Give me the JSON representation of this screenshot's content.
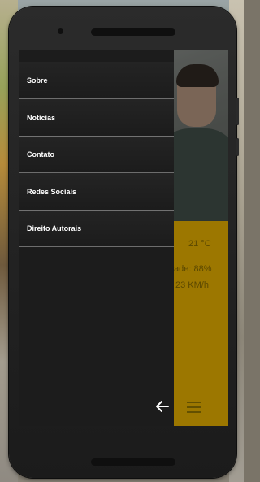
{
  "drawer": {
    "items": [
      {
        "label": "Sobre"
      },
      {
        "label": "Notícias"
      },
      {
        "label": "Contato"
      },
      {
        "label": "Redes Sociais"
      },
      {
        "label": "Direito Autorais"
      }
    ],
    "back_icon": "arrow-left-icon"
  },
  "weather": {
    "temperature": "21 °C",
    "humidity": "ade: 88%",
    "wind": "23 KM/h"
  },
  "colors": {
    "accent": "#d9a500",
    "drawer": "#1c1c1c"
  },
  "menu_icon": "hamburger-menu-icon"
}
